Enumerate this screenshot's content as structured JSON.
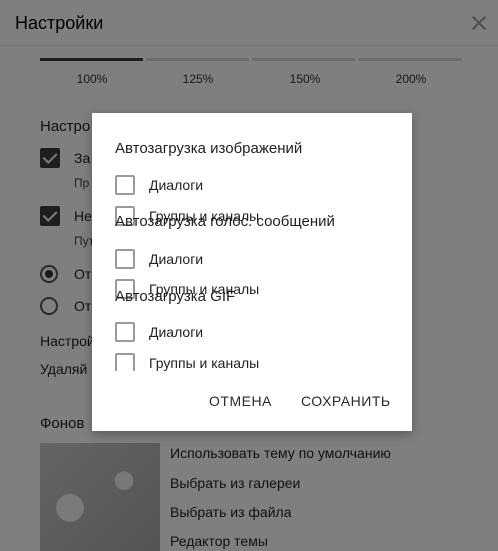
{
  "settings": {
    "title": "Настройки",
    "scale": {
      "options": [
        "100%",
        "125%",
        "150%",
        "200%"
      ],
      "selected": "100%"
    },
    "section_heading": "Настро",
    "rows": [
      {
        "text": "За",
        "sub": "Пр"
      },
      {
        "text": "Не",
        "sub": "Пут"
      }
    ],
    "radios": [
      "От",
      "От"
    ],
    "plain_rows": [
      "Настрой",
      "Удаляй"
    ],
    "background_heading": "Фонов",
    "background_options": [
      "Использовать тему по умолчанию",
      "Выбрать из галереи",
      "Выбрать из файла",
      "Редактор темы"
    ]
  },
  "dialog": {
    "sections": [
      {
        "heading": "Автозагрузка изображений",
        "options": [
          "Диалоги",
          "Группы и каналы"
        ]
      },
      {
        "heading": "Автозагрузка голос. сообщений",
        "options": [
          "Диалоги",
          "Группы и каналы"
        ]
      },
      {
        "heading": "Автозагрузка GIF",
        "options": [
          "Диалоги",
          "Группы и каналы"
        ]
      }
    ],
    "cancel_label": "ОТМЕНА",
    "save_label": "СОХРАНИТЬ"
  }
}
